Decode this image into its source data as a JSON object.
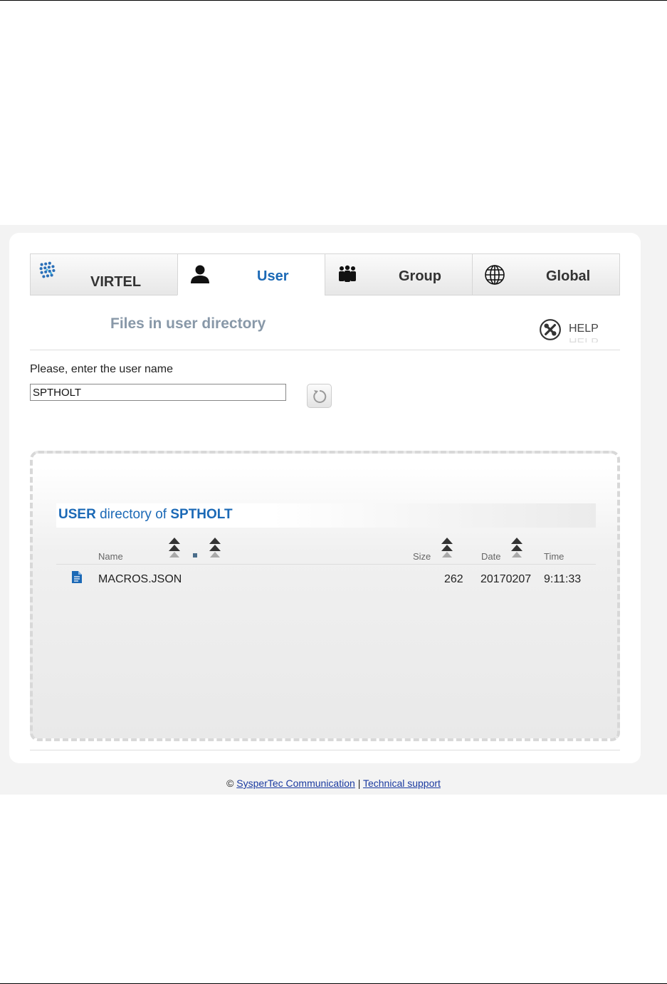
{
  "tabs": [
    {
      "label": "VIRTEL",
      "icon": "virtel-logo-icon"
    },
    {
      "label": "User",
      "icon": "user-icon",
      "active": true
    },
    {
      "label": "Group",
      "icon": "group-icon"
    },
    {
      "label": "Global",
      "icon": "globe-icon"
    }
  ],
  "section": {
    "title": "Files in user directory",
    "help_label": "HELP"
  },
  "form": {
    "prompt": "Please, enter the user name",
    "user_value": "SPTHOLT"
  },
  "directory": {
    "title_prefix": "USER",
    "title_middle": " directory of ",
    "title_user": "SPTHOLT",
    "columns": {
      "name": "Name",
      "size": "Size",
      "date": "Date",
      "time": "Time"
    },
    "files": [
      {
        "name": "MACROS.JSON",
        "size": "262",
        "date": "20170207",
        "time": "9:11:33"
      }
    ]
  },
  "footer": {
    "copyright_symbol": "©",
    "company_link": "SysperTec Communication",
    "separator": "|",
    "support_link": "Technical support"
  },
  "colors": {
    "accent": "#1b69b6",
    "title_gray": "#8898a8"
  }
}
